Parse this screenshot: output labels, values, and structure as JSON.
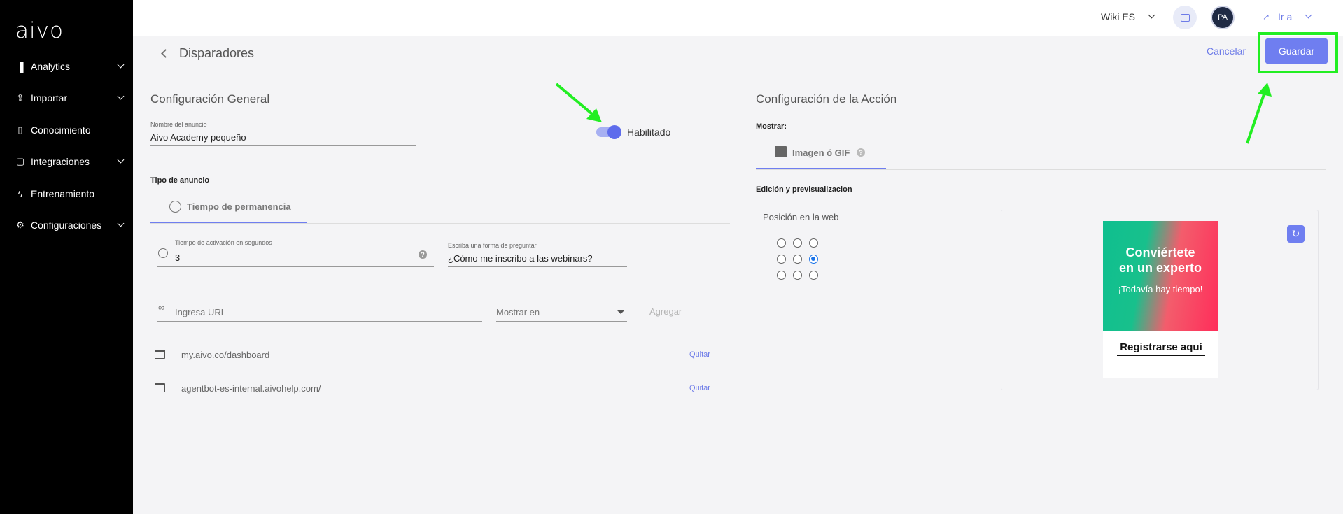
{
  "app": {
    "logo": "aivo"
  },
  "sidebar": {
    "items": [
      {
        "label": "Analytics",
        "icon": "bar-chart-icon",
        "expandable": true
      },
      {
        "label": "Importar",
        "icon": "upload-icon",
        "expandable": true
      },
      {
        "label": "Conocimiento",
        "icon": "book-icon",
        "expandable": false
      },
      {
        "label": "Integraciones",
        "icon": "chat-icon",
        "expandable": true
      },
      {
        "label": "Entrenamiento",
        "icon": "bolt-icon",
        "expandable": false
      },
      {
        "label": "Configuraciones",
        "icon": "gear-icon",
        "expandable": true
      }
    ]
  },
  "topbar": {
    "workspace": "Wiki ES",
    "avatar_initials": "PA",
    "goto_label": "Ir a"
  },
  "header": {
    "title": "Disparadores",
    "cancel_label": "Cancelar",
    "save_label": "Guardar"
  },
  "general": {
    "title": "Configuración General",
    "name_label": "Nombre del anuncio",
    "name_value": "Aivo Academy pequeño",
    "enabled_label": "Habilitado",
    "enabled": true,
    "type_label": "Tipo de anuncio",
    "type_tab": "Tiempo de permanencia",
    "activation_label": "Tiempo de activación en segundos",
    "activation_value": "3",
    "question_label": "Escriba una forma de preguntar",
    "question_value": "¿Cómo me inscribo a las webinars?",
    "url_placeholder": "Ingresa URL",
    "show_in_placeholder": "Mostrar en",
    "add_label": "Agregar",
    "urls": [
      {
        "url": "my.aivo.co/dashboard",
        "remove_label": "Quitar"
      },
      {
        "url": "agentbot-es-internal.aivohelp.com/",
        "remove_label": "Quitar"
      }
    ]
  },
  "action": {
    "title": "Configuración de la Acción",
    "show_label": "Mostrar:",
    "show_tab": "Imagen ó GIF",
    "edit_label": "Edición y previsualizacion",
    "position_label": "Posición en la web",
    "selected_position": "middle-right",
    "banner": {
      "headline_1": "Conviértete",
      "headline_2": "en un experto",
      "subline": "¡Todavía hay tiempo!",
      "cta": "Registrarse aquí"
    }
  },
  "colors": {
    "accent": "#6f7ef0",
    "sidebar": "#000000",
    "annotation": "#22ee22"
  }
}
